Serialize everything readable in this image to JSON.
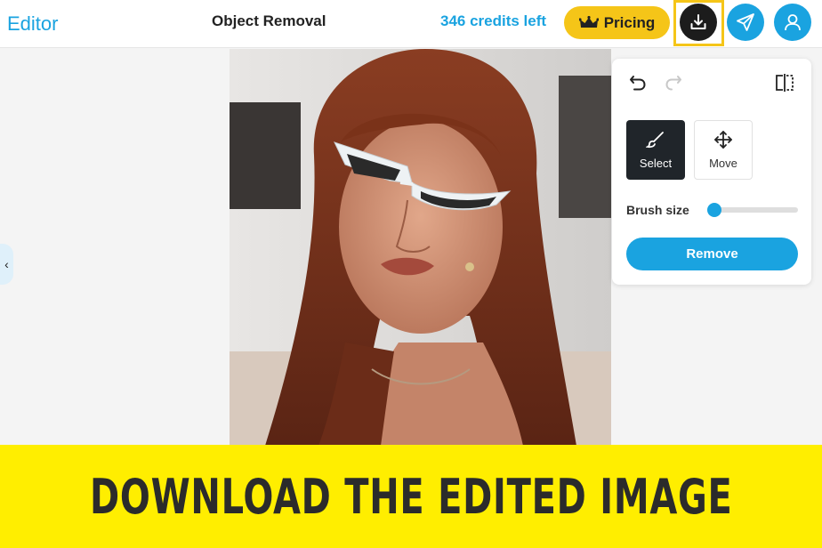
{
  "header": {
    "brand": "Editor",
    "title": "Object Removal",
    "credits": "346 credits left",
    "pricing_label": "Pricing",
    "pricing_icon": "crown-icon",
    "download_icon": "download-icon",
    "share_icon": "paper-plane-icon",
    "account_icon": "user-icon"
  },
  "panel": {
    "undo_icon": "undo-icon",
    "redo_icon": "redo-icon",
    "compare_icon": "compare-icon",
    "tools": [
      {
        "label": "Select",
        "icon": "brush-icon",
        "active": true
      },
      {
        "label": "Move",
        "icon": "move-icon",
        "active": false
      }
    ],
    "brush_size_label": "Brush size",
    "brush_size_value": 0.07,
    "remove_label": "Remove"
  },
  "caption": "DOWNLOAD THE EDITED IMAGE",
  "colors": {
    "accent": "#1aa3e0",
    "pricing": "#f5c518",
    "highlight": "#f5c518",
    "banner": "#ffee00",
    "download_button": "#1c1c1c"
  }
}
